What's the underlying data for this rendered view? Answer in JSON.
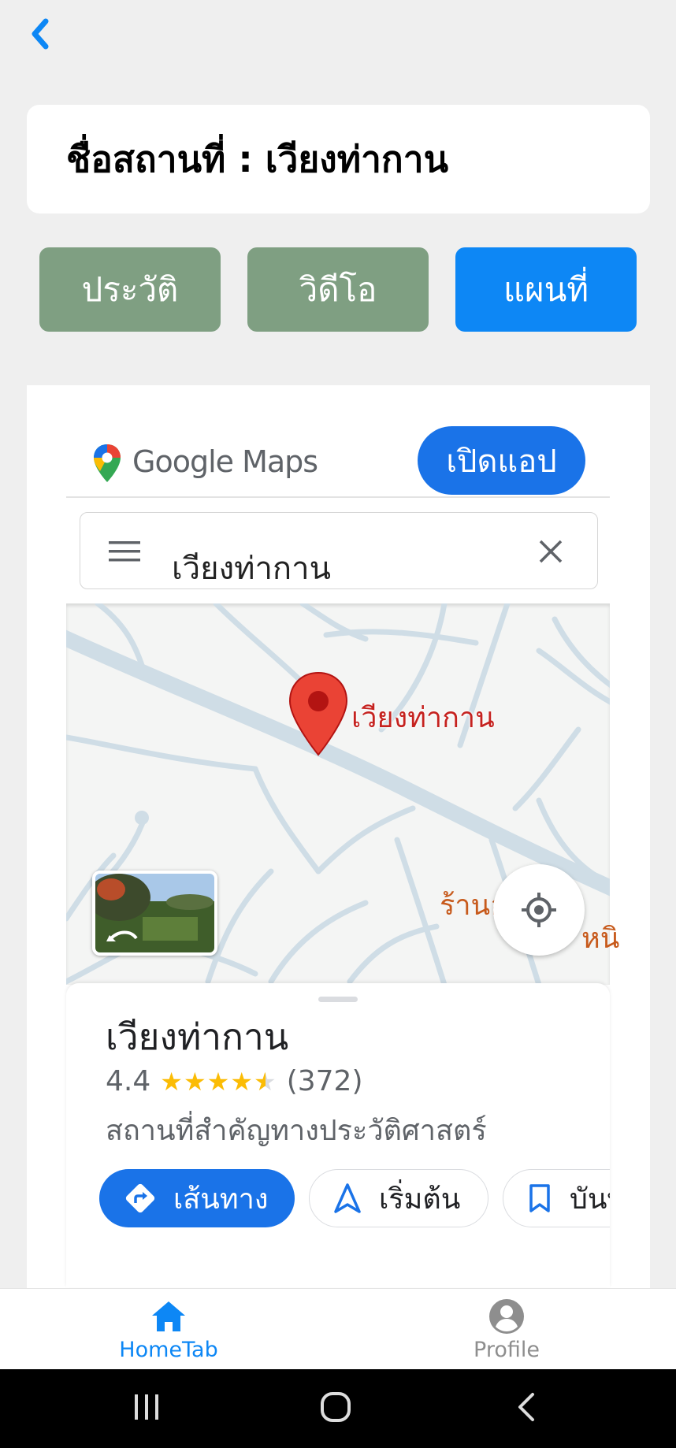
{
  "header": {
    "back_icon": "chevron-left-icon"
  },
  "title": {
    "text": "ชื่อสถานที่ : เวียงท่ากาน"
  },
  "tabs": [
    {
      "label": "ประวัติ",
      "color": "#7f9f82"
    },
    {
      "label": "วิดีโอ",
      "color": "#7f9f82"
    },
    {
      "label": "แผนที่",
      "color": "#0d87f5",
      "selected": true
    }
  ],
  "map_embed": {
    "brand": "Google Maps",
    "open_app_label": "เปิดแอป",
    "search_value": "เวียงท่ากาน",
    "pin_label": "เวียงท่ากาน",
    "nearby_label_line1": "ร้านอาหา",
    "nearby_label_line2": "หนิ"
  },
  "place": {
    "name": "เวียงท่ากาน",
    "rating": "4.4",
    "stars": 4.5,
    "reviews": "(372)",
    "category": "สถานที่สำคัญทางประวัติศาสตร์",
    "actions": {
      "directions": "เส้นทาง",
      "start": "เริ่มต้น",
      "save": "บันทึก"
    }
  },
  "bottom_nav": {
    "home_label": "HomeTab",
    "profile_label": "Profile",
    "active_color": "#0d87f5"
  }
}
